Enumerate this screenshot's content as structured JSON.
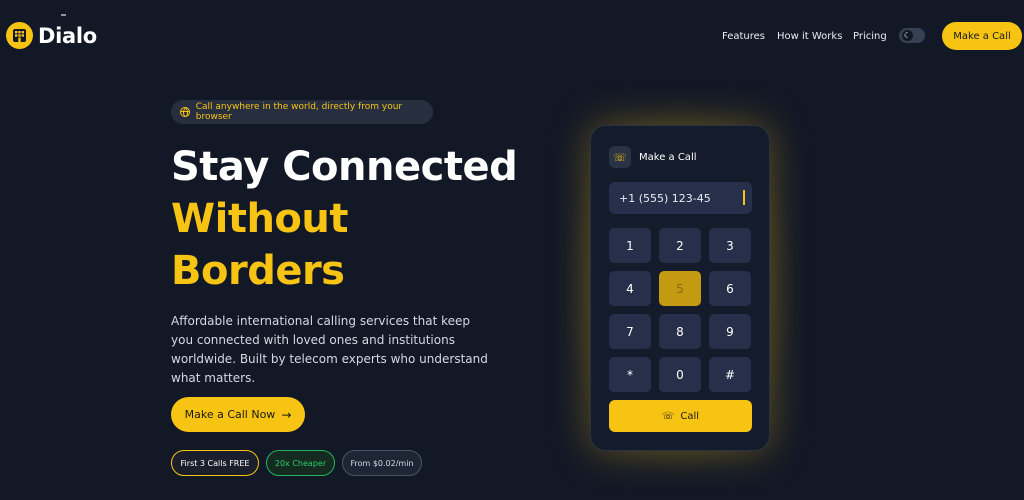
{
  "brand": {
    "name": "Dialo",
    "accent": "#f8c414",
    "background": "#121826"
  },
  "nav": {
    "links": [
      "Features",
      "How it Works",
      "Pricing"
    ],
    "theme_toggle_icon": "moon-icon",
    "cta": "Make a Call"
  },
  "hero": {
    "pill": "Call anywhere in the world, directly from your browser",
    "headline_line1": "Stay Connected",
    "headline_line2": "Without",
    "headline_line3": "Borders",
    "description": "Affordable international calling services that keep you connected with loved ones and institutions worldwide. Built by telecom experts who understand what matters.",
    "cta": "Make a Call Now",
    "badges": [
      "First 3 Calls FREE",
      "20x Cheaper",
      "From $0.02/min"
    ]
  },
  "dialer": {
    "title": "Make a Call",
    "number": "+1 (555) 123-45",
    "keys": [
      "1",
      "2",
      "3",
      "4",
      "5",
      "6",
      "7",
      "8",
      "9",
      "*",
      "0",
      "#"
    ],
    "active_key": "5",
    "call_label": "Call"
  }
}
